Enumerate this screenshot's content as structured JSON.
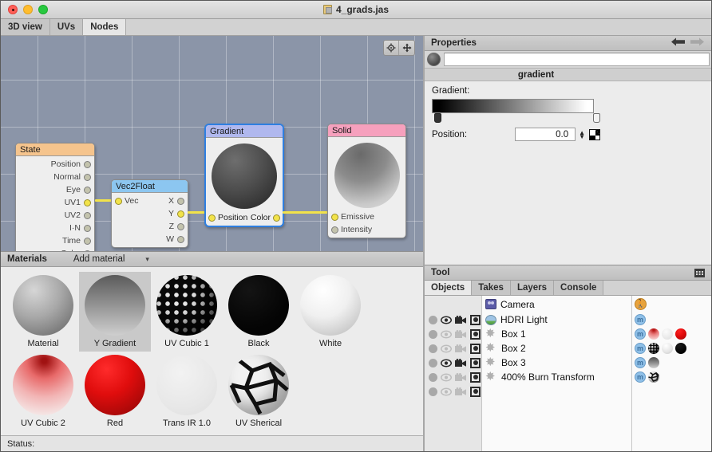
{
  "window": {
    "title": "4_grads.jas",
    "doc_icon": "document-icon",
    "traffic": {
      "close": "close-button",
      "minimize": "minimize-button",
      "zoom": "zoom-button"
    }
  },
  "view_tabs": [
    {
      "label": "3D view",
      "active": false
    },
    {
      "label": "UVs",
      "active": false
    },
    {
      "label": "Nodes",
      "active": true
    }
  ],
  "node_graph": {
    "tools": [
      {
        "name": "target-icon",
        "label": "⊙"
      },
      {
        "name": "move-icon",
        "label": "✥"
      }
    ],
    "nodes": [
      {
        "title": "State",
        "header_color": "#f5c48d",
        "selected": false,
        "outputs": [
          "Position",
          "Normal",
          "Eye",
          "UV1",
          "UV2",
          "I·N",
          "Time",
          "Color"
        ],
        "active_outputs": [
          "UV1"
        ]
      },
      {
        "title": "Vec2Float",
        "header_color": "#8cc6f0",
        "selected": false,
        "inputs": [
          "Vec"
        ],
        "active_inputs": [
          "Vec"
        ],
        "outputs": [
          "X",
          "Y",
          "Z",
          "W"
        ],
        "active_outputs": [
          "Y"
        ]
      },
      {
        "title": "Gradient",
        "header_color": "#b0b8ee",
        "selected": true,
        "inputs": [
          "Position"
        ],
        "active_inputs": [
          "Position"
        ],
        "outputs": [
          "Color"
        ],
        "active_outputs": [
          "Color"
        ]
      },
      {
        "title": "Solid",
        "header_color": "#f6a0bd",
        "selected": false,
        "inputs": [
          "Emissive",
          "Intensity"
        ],
        "active_inputs": [
          "Emissive"
        ]
      }
    ],
    "wire_color": "#f2e34a"
  },
  "materials_panel": {
    "title": "Materials",
    "add_material_label": "Add material",
    "dropdown_icon": "chevron-down-icon",
    "items": [
      {
        "label": "Material",
        "selected": false,
        "style": "gray"
      },
      {
        "label": "Y Gradient",
        "selected": true,
        "style": "ygradient"
      },
      {
        "label": "UV Cubic 1",
        "selected": false,
        "style": "uvcubic1"
      },
      {
        "label": "Black",
        "selected": false,
        "style": "black"
      },
      {
        "label": "White",
        "selected": false,
        "style": "white"
      },
      {
        "label": "UV Cubic 2",
        "selected": false,
        "style": "uvcubic2"
      },
      {
        "label": "Red",
        "selected": false,
        "style": "red"
      },
      {
        "label": "Trans IR 1.0",
        "selected": false,
        "style": "trans"
      },
      {
        "label": "UV Sherical",
        "selected": false,
        "style": "uvspherical"
      }
    ]
  },
  "status_bar": {
    "label": "Status:"
  },
  "properties": {
    "title": "Properties",
    "back_icon": "arrow-left-icon",
    "forward_icon": "arrow-right-icon",
    "preview_icon": "material-preview-sphere",
    "name_value": "",
    "section_title": "gradient",
    "gradient_label": "Gradient:",
    "gradient_from": "#000000",
    "gradient_to": "#ffffff",
    "stops": [
      {
        "name": "gradient-stop-left",
        "position": 0.0,
        "color": "#000000"
      },
      {
        "name": "gradient-stop-right",
        "position": 1.0,
        "color": "#ffffff"
      }
    ],
    "position_label": "Position:",
    "position_value": "0.0",
    "stepper_icon": "stepper-updown-icon",
    "color_swatch_icon": "checkerboard-swatch-icon"
  },
  "tool": {
    "title": "Tool",
    "grid_icon": "grid-icon",
    "tabs": [
      {
        "label": "Objects",
        "active": true
      },
      {
        "label": "Takes",
        "active": false
      },
      {
        "label": "Layers",
        "active": false
      },
      {
        "label": "Console",
        "active": false
      }
    ],
    "objects": [
      {
        "name": "Camera",
        "icon": "camera-object-icon",
        "toggles": {
          "select": true,
          "visible": true,
          "render": true,
          "record": true
        },
        "badges": [
          "runner"
        ],
        "materials": []
      },
      {
        "name": "HDRI Light",
        "icon": "hdri-light-icon",
        "toggles": {
          "select": true,
          "visible": false,
          "render": false,
          "record": true
        },
        "badges": [
          "m"
        ],
        "materials": []
      },
      {
        "name": "Box 1",
        "icon": "box-object-icon",
        "toggles": {
          "select": true,
          "visible": true,
          "render": true,
          "record": true
        },
        "badges": [
          "m"
        ],
        "materials": [
          "uvcubic2",
          "trans",
          "red"
        ]
      },
      {
        "name": "Box 2",
        "icon": "box-object-icon",
        "toggles": {
          "select": true,
          "visible": false,
          "render": false,
          "record": true
        },
        "badges": [
          "m"
        ],
        "materials": [
          "uvcubic1",
          "white",
          "black"
        ]
      },
      {
        "name": "Box 3",
        "icon": "box-object-icon",
        "toggles": {
          "select": true,
          "visible": false,
          "render": false,
          "record": true
        },
        "badges": [
          "m"
        ],
        "materials": [
          "ygradient"
        ]
      },
      {
        "name": "400% Burn Transform",
        "icon": "box-object-icon",
        "toggles": {
          "select": true,
          "visible": false,
          "render": false,
          "record": true
        },
        "badges": [
          "m"
        ],
        "materials": [
          "uvspherical"
        ]
      }
    ]
  }
}
